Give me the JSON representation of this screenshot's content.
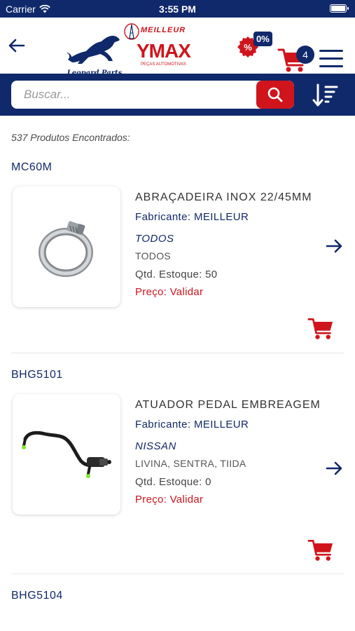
{
  "status_bar": {
    "carrier": "Carrier",
    "time": "3:55 PM"
  },
  "header": {
    "brand_left": "Leopard Parts",
    "brand_right_top": "MEILLEUR",
    "brand_right_main": "YMAX",
    "brand_right_sub": "PEÇAS AUTOMOTIVAS",
    "promo_percent": "0%",
    "cart_count": "4"
  },
  "search": {
    "placeholder": "Buscar...",
    "value": ""
  },
  "results": {
    "count_text": "537 Produtos Encontrados:"
  },
  "products": [
    {
      "code": "MC60M",
      "name": "ABRAÇADEIRA INOX 22/45MM",
      "manufacturer": "Fabricante: MEILLEUR",
      "brand": "TODOS",
      "models": "TODOS",
      "stock": "Qtd. Estoque: 50",
      "price": "Preço: Validar",
      "image_icon": "hose-clamp-image"
    },
    {
      "code": "BHG5101",
      "name": "ATUADOR PEDAL EMBREAGEM",
      "manufacturer": "Fabricante: MEILLEUR",
      "brand": "NISSAN",
      "models": "LIVINA, SENTRA, TIIDA",
      "stock": "Qtd. Estoque: 0",
      "price": "Preço: Validar",
      "image_icon": "clutch-line-image"
    },
    {
      "code": "BHG5104"
    }
  ],
  "colors": {
    "navy": "#10296b",
    "red": "#d0141c"
  }
}
